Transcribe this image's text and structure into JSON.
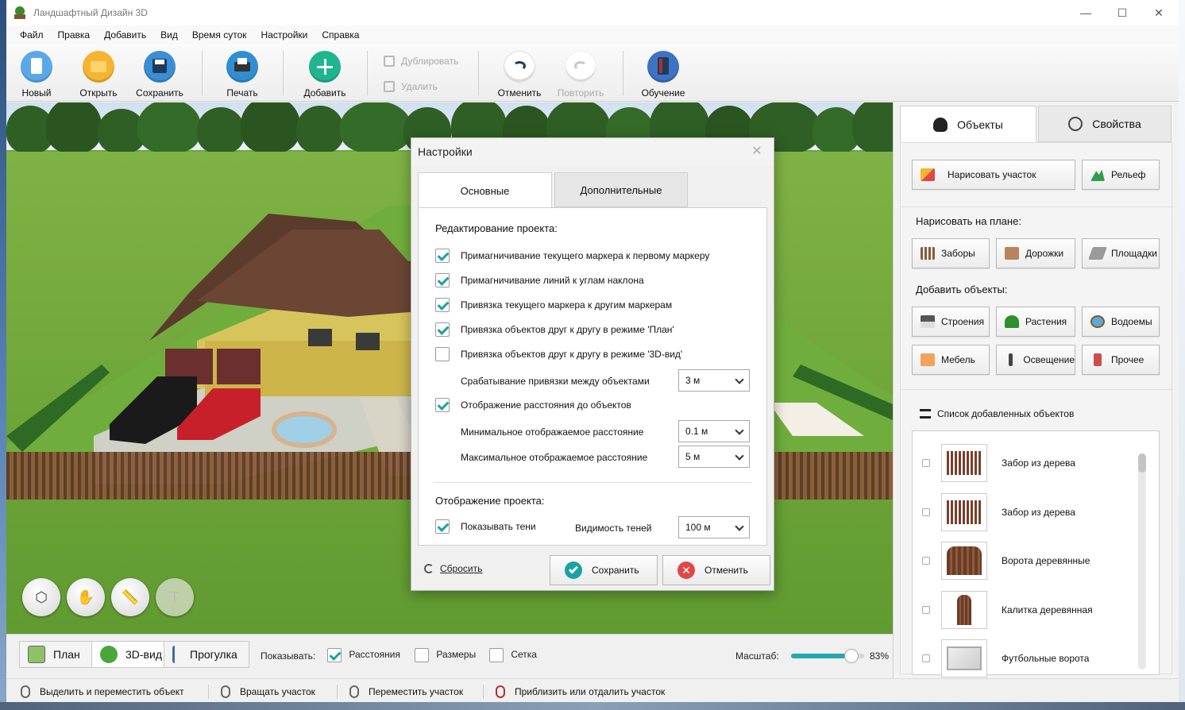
{
  "window": {
    "title": "Ландшафтный Дизайн 3D",
    "controls": [
      "—",
      "☐",
      "✕"
    ]
  },
  "menu": [
    "Файл",
    "Правка",
    "Добавить",
    "Вид",
    "Время суток",
    "Настройки",
    "Справка"
  ],
  "toolbar": {
    "new": "Новый",
    "open": "Открыть",
    "save": "Сохранить",
    "print": "Печать",
    "add": "Добавить",
    "duplicate": "Дублировать",
    "delete": "Удалить",
    "undo": "Отменить",
    "redo": "Повторить",
    "tutorial": "Обучение"
  },
  "settings_dialog": {
    "title": "Настройки",
    "tabs": [
      "Основные",
      "Дополнительные"
    ],
    "section_editing": "Редактирование проекта:",
    "options": [
      {
        "label": "Примагничивание текущего маркера к первому маркеру",
        "checked": true
      },
      {
        "label": "Примагничивание линий к углам наклона",
        "checked": true
      },
      {
        "label": "Привязка текущего маркера к другим маркерам",
        "checked": true
      },
      {
        "label": "Привязка объектов друг к другу в режиме 'План'",
        "checked": true
      },
      {
        "label": "Привязка объектов друг к другу в режиме '3D-вид'",
        "checked": false
      }
    ],
    "snap_distance_label": "Срабатывание привязки между объектами",
    "snap_distance_value": "3  м",
    "show_distance_label": "Отображение расстояния до объектов",
    "show_distance_checked": true,
    "min_distance_label": "Минимальное отображаемое расстояние",
    "min_distance_value": "0.1  м",
    "max_distance_label": "Максимальное отображаемое расстояние",
    "max_distance_value": "5  м",
    "section_display": "Отображение проекта:",
    "show_shadows_label": "Показывать тени",
    "show_shadows_checked": true,
    "shadow_visibility_label": "Видимость теней",
    "shadow_visibility_value": "100  м",
    "reset": "Сбросить",
    "save": "Сохранить",
    "cancel": "Отменить"
  },
  "view_bar": {
    "tabs": [
      "План",
      "3D-вид",
      "Прогулка"
    ],
    "active_tab": "3D-вид",
    "show_label": "Показывать:",
    "show_distances": "Расстояния",
    "show_distances_checked": true,
    "show_sizes": "Размеры",
    "show_grid": "Сетка",
    "scale_label": "Масштаб:",
    "scale_value": "83%",
    "scale_fraction": 0.83
  },
  "status_bar": [
    "Выделить и переместить объект",
    "Вращать участок",
    "Переместить участок",
    "Приблизить или отдалить участок"
  ],
  "right_panel": {
    "tabs": [
      "Объекты",
      "Свойства"
    ],
    "active_tab": "Объекты",
    "draw_plot": "Нарисовать участок",
    "relief": "Рельеф",
    "draw_on_plan": "Нарисовать на плане:",
    "draw_items": [
      "Заборы",
      "Дорожки",
      "Площадки"
    ],
    "add_objects": "Добавить объекты:",
    "add_items": [
      "Строения",
      "Растения",
      "Водоемы",
      "Мебель",
      "Освещение",
      "Прочее"
    ],
    "list_title": "Список добавленных объектов",
    "objects": [
      "Забор из дерева",
      "Забор из дерева",
      "Ворота деревянные",
      "Калитка деревянная",
      "Футбольные ворота"
    ]
  },
  "colors": {
    "accent": "#1aa3a3",
    "new_icon": "#5aa8e8",
    "open_icon": "#f5b431",
    "save_icon": "#3a8ed6",
    "print_icon": "#2f8fd2",
    "add_icon": "#1fb58f",
    "tutorial_icon": "#3d73c4",
    "cancel_red": "#e04848"
  }
}
